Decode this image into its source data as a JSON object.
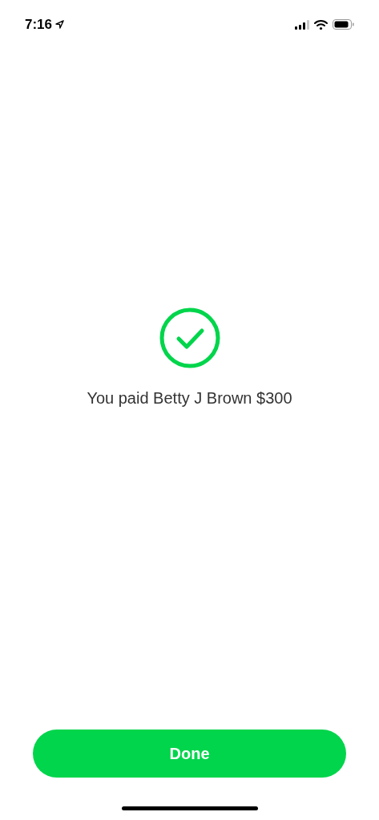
{
  "status_bar": {
    "time": "7:16"
  },
  "confirmation": {
    "message": "You paid Betty J Brown $300"
  },
  "done_button": {
    "label": "Done"
  }
}
